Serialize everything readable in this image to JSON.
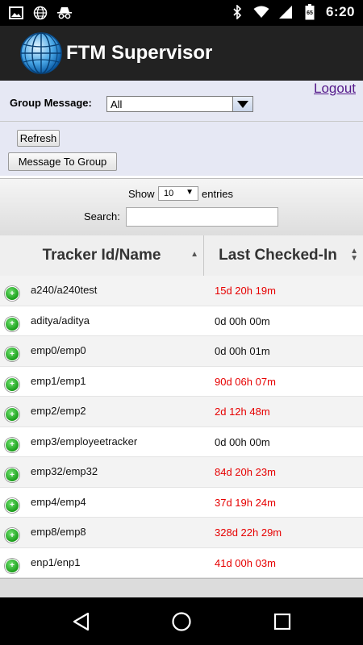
{
  "status_bar": {
    "time": "6:20",
    "left_icons": [
      "image-icon",
      "globe-icon",
      "incognito-icon"
    ],
    "right_icons": [
      "bluetooth-icon",
      "wifi-icon",
      "signal-icon",
      "battery-icon"
    ],
    "battery_text": "65"
  },
  "app_bar": {
    "title": "FTM Supervisor"
  },
  "controls": {
    "logout_label": "Logout",
    "group_message_label": "Group Message:",
    "group_selected": "All",
    "refresh_label": "Refresh",
    "message_group_label": "Message To Group"
  },
  "datatable": {
    "show_label": "Show",
    "entries_value": "10",
    "entries_label": "entries",
    "search_label": "Search:",
    "search_value": "",
    "columns": [
      "Tracker Id/Name",
      "Last Checked-In"
    ],
    "rows": [
      {
        "tracker": "a240/a240test",
        "checked": "15d 20h 19m",
        "overdue": true
      },
      {
        "tracker": "aditya/aditya",
        "checked": "0d 00h 00m",
        "overdue": false
      },
      {
        "tracker": "emp0/emp0",
        "checked": "0d 00h 01m",
        "overdue": false
      },
      {
        "tracker": "emp1/emp1",
        "checked": "90d 06h 07m",
        "overdue": true
      },
      {
        "tracker": "emp2/emp2",
        "checked": "2d 12h 48m",
        "overdue": true
      },
      {
        "tracker": "emp3/employeetracker",
        "checked": "0d 00h 00m",
        "overdue": false
      },
      {
        "tracker": "emp32/emp32",
        "checked": "84d 20h 23m",
        "overdue": true
      },
      {
        "tracker": "emp4/emp4",
        "checked": "37d 19h 24m",
        "overdue": true
      },
      {
        "tracker": "emp8/emp8",
        "checked": "328d 22h 29m",
        "overdue": true
      },
      {
        "tracker": "enp1/enp1",
        "checked": "41d 00h 03m",
        "overdue": true
      }
    ]
  },
  "colors": {
    "overdue": "#e60000",
    "normal": "#111111",
    "expand_button": "#22a622",
    "app_bar": "#222222",
    "controls_bg": "#e6e8f4"
  },
  "nav_bar": {
    "icons": [
      "back-icon",
      "home-icon",
      "recents-icon"
    ]
  }
}
